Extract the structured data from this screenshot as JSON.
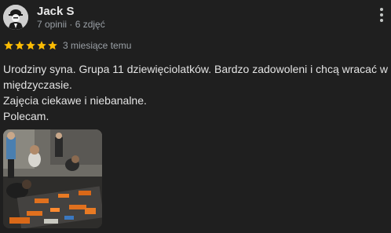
{
  "author": {
    "name": "Jack S",
    "meta": "7 opinii · 6 zdjęć"
  },
  "rating": {
    "stars": 5,
    "max": 5,
    "star_color": "#fbbc04"
  },
  "review_date": "3 miesiące temu",
  "review_text": "Urodziny syna. Grupa 11 dziewięciolatków. Bardzo zadowoleni i chcą wracać w\nmiędzyczasie.\nZajęcia ciekawe i niebanalne.\nPolecam.",
  "icons": {
    "menu": "more-vert-icon",
    "avatar": "user-avatar",
    "star": "star-icon"
  }
}
